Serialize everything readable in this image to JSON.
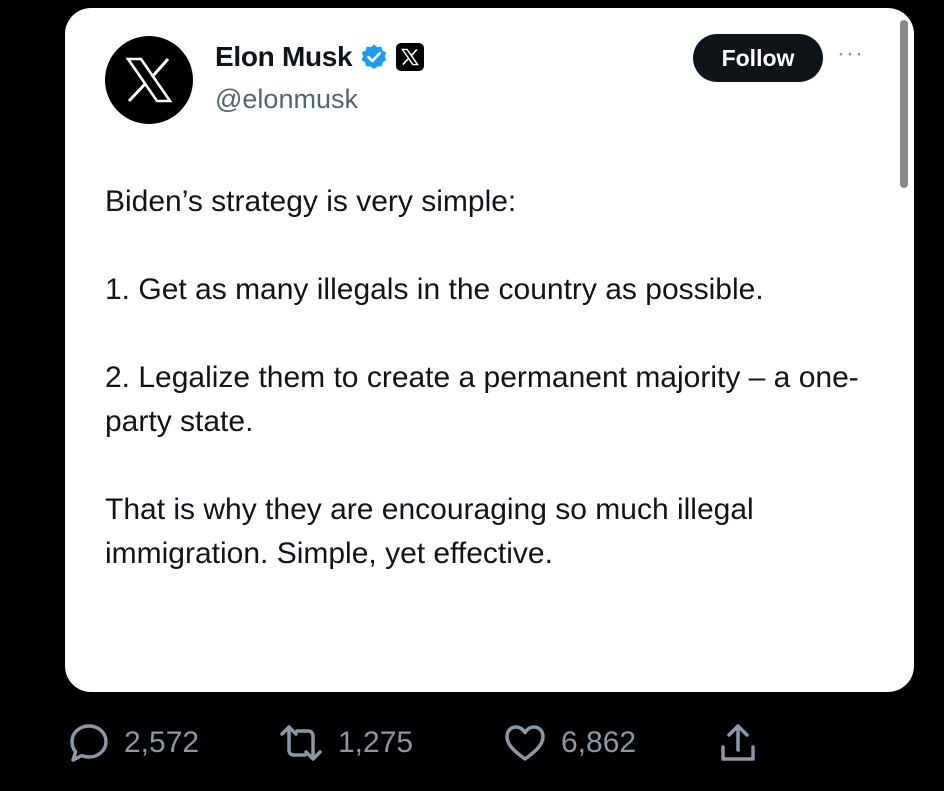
{
  "post": {
    "author": {
      "name": "Elon Musk",
      "handle": "@elonmusk",
      "verified": true,
      "avatar_icon": "x-logo-icon",
      "affiliation_badge_icon": "x-logo-icon"
    },
    "follow_label": "Follow",
    "more_label": "···",
    "paragraphs": [
      "Biden’s strategy is very simple:",
      "1. Get as many illegals in the country as possible.",
      "2. Legalize them to create a permanent majority – a one-party state.",
      "That is why they are encouraging so much illegal immigration. Simple, yet effective."
    ]
  },
  "actions": {
    "replies": {
      "icon": "reply-icon",
      "count": "2,572"
    },
    "reposts": {
      "icon": "repost-icon",
      "count": "1,275"
    },
    "likes": {
      "icon": "heart-icon",
      "count": "6,862"
    },
    "share": {
      "icon": "share-icon"
    }
  },
  "colors": {
    "background": "#000000",
    "card": "#ffffff",
    "text": "#0f1419",
    "secondary": "#536471",
    "action_gray": "#8b98a5",
    "verified_blue": "#1d9bf0",
    "button": "#0f1419"
  }
}
